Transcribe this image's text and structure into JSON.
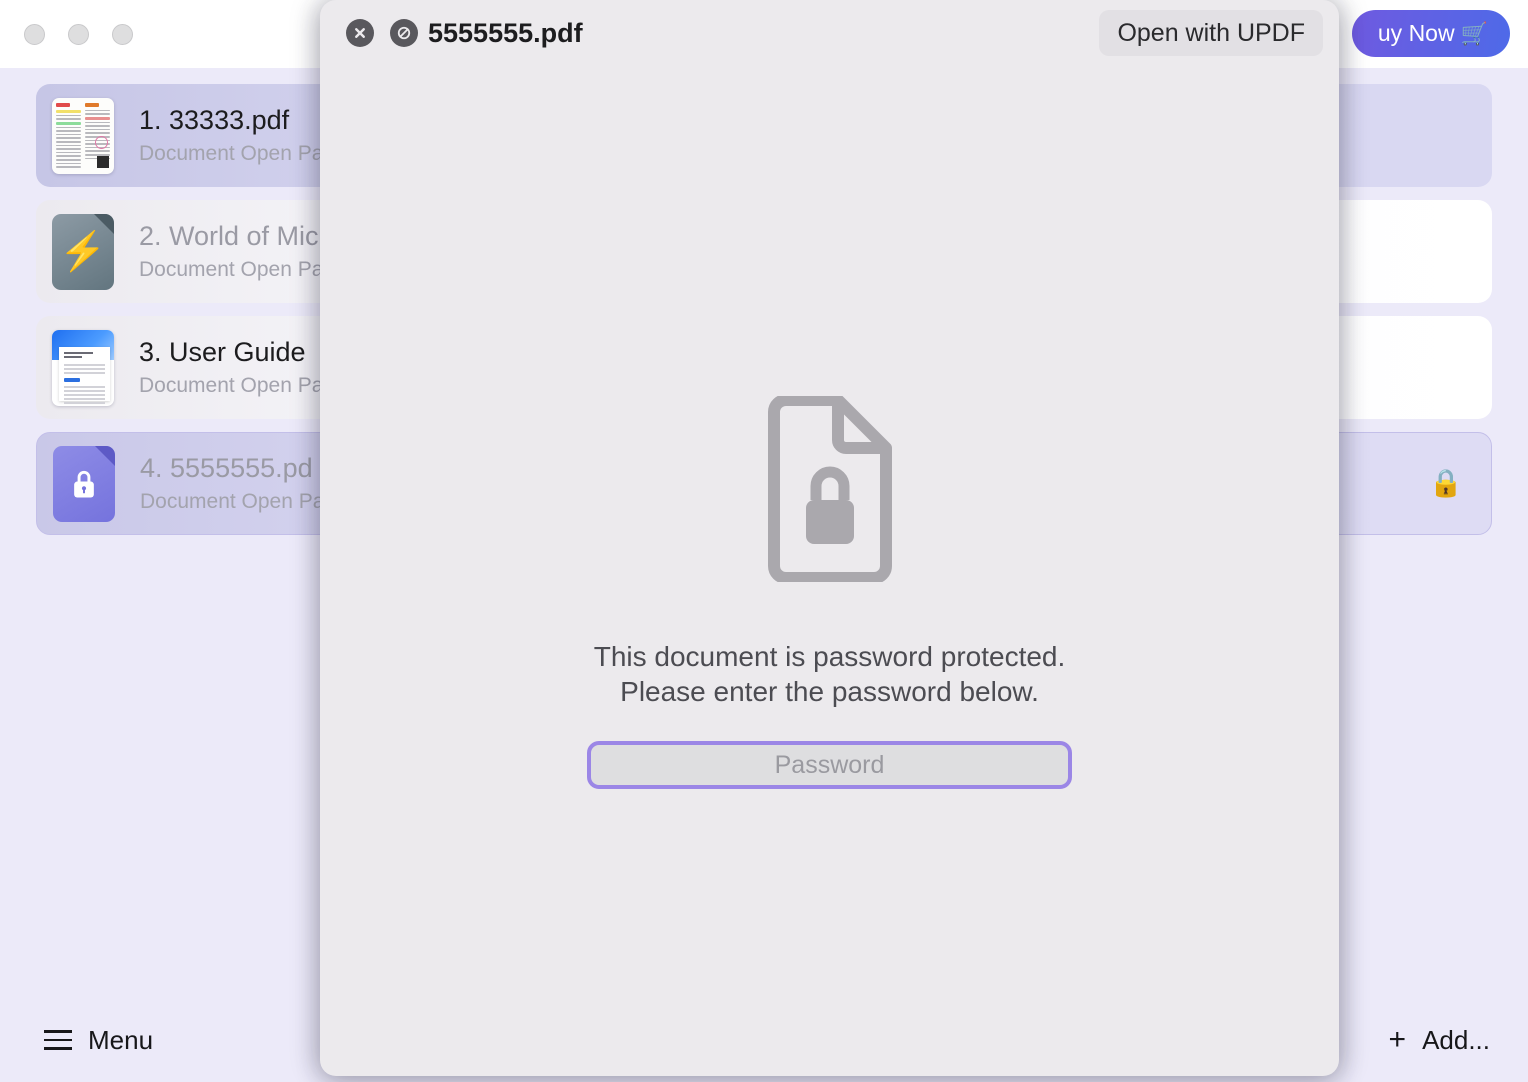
{
  "window": {
    "traffic_lights": [
      "close",
      "minimize",
      "maximize"
    ],
    "buy_now_label": "uy Now",
    "cart_icon": "shopping-cart-icon"
  },
  "documents": [
    {
      "title": "1. 33333.pdf",
      "subtitle": "Document Open Pa",
      "thumbnail": "scanned-document-thumbnail",
      "state": "selected",
      "lock_badge": ""
    },
    {
      "title": "2. World of Mic",
      "subtitle": "Document Open Pa",
      "thumbnail": "lightning-document-icon",
      "state": "plain",
      "lock_badge": ""
    },
    {
      "title": "3. User Guide",
      "subtitle": "Document Open Pa",
      "thumbnail": "user-guide-cover-thumbnail",
      "state": "plain",
      "lock_badge": ""
    },
    {
      "title": "4. 5555555.pd",
      "subtitle": "Document Open Pa",
      "thumbnail": "locked-document-icon",
      "state": "locked",
      "lock_badge": "🔒"
    }
  ],
  "bottom_bar": {
    "menu_label": "Menu",
    "menu_icon": "hamburger-icon",
    "add_label": "Add...",
    "add_icon": "plus-icon"
  },
  "modal": {
    "close_icon": "close-circle-icon",
    "block_icon": "no-entry-circle-icon",
    "filename": "5555555.pdf",
    "open_with_label": "Open with UPDF",
    "doc_icon": "locked-document-outline-icon",
    "message_line1": "This document is password protected.",
    "message_line2": "Please enter the password below.",
    "password_placeholder": "Password",
    "password_value": ""
  },
  "colors": {
    "app_background": "#eceaf9",
    "modal_background": "#eceaed",
    "accent_purple": "#9b86e6",
    "buy_now_gradient_start": "#6f5ae0",
    "buy_now_gradient_end": "#4e6ae8",
    "selected_row": "#d8d7f1",
    "lock_badge_gold": "#e8c466"
  }
}
